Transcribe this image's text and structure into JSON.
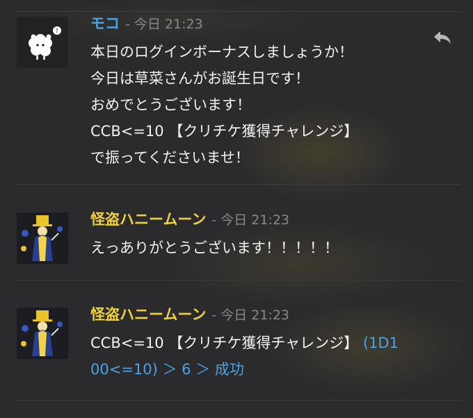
{
  "messages": [
    {
      "author": "モコ",
      "timestamp": "- 今日 21:23",
      "lines": [
        "本日のログインボーナスしましょうか！",
        "今日は草菜さんがお誕生日です！",
        "おめでとうございます！",
        "CCB<=10 【クリチケ獲得チャレンジ】",
        "で振ってくださいませ！"
      ]
    },
    {
      "author": "怪盗ハニームーン",
      "timestamp": "- 今日 21:23",
      "lines": [
        "えっありがとうございます！！！！！"
      ]
    },
    {
      "author": "怪盗ハニームーン",
      "timestamp": "- 今日 21:23",
      "command": "CCB<=10 【クリチケ獲得チャレンジ】",
      "result_part1": "(1D1",
      "result_part2": "00<=10) ＞ 6 ＞ 成功"
    }
  ],
  "colors": {
    "background": "#2b2b2d",
    "author_moko": "#4aa3e6",
    "author_honey": "#f2d23a",
    "timestamp": "#8a8a8c",
    "dice_result": "#4aa3e6"
  },
  "icons": {
    "reply": "reply-icon"
  }
}
